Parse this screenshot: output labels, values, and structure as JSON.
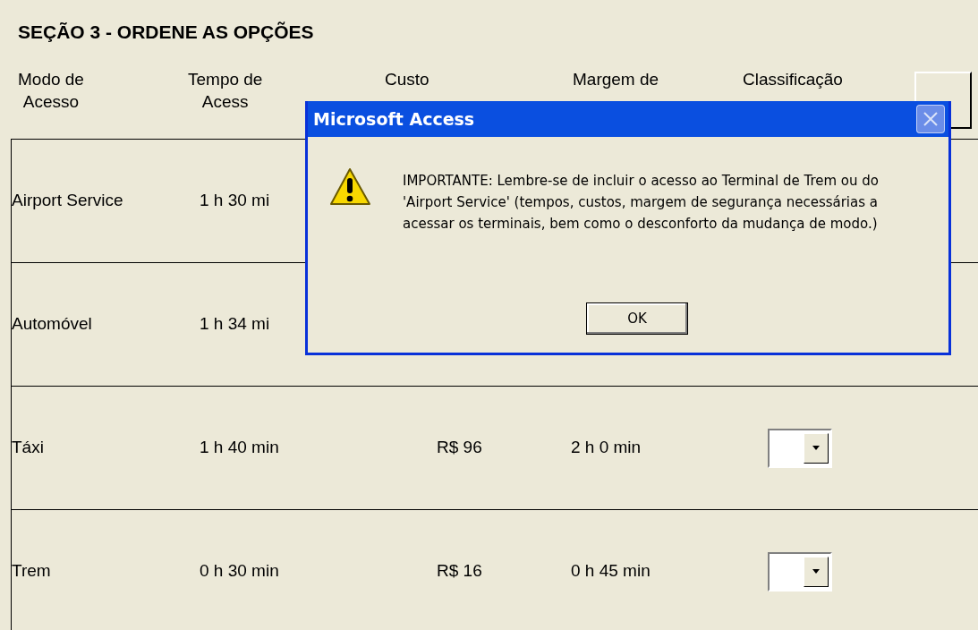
{
  "section_title": "SEÇÃO 3 - ORDENE AS OPÇÕES",
  "columns": [
    {
      "lines": [
        "Modo de",
        "Acesso"
      ]
    },
    {
      "lines": [
        "Tempo de",
        "Acess"
      ]
    },
    {
      "lines": [
        "Custo"
      ]
    },
    {
      "lines": [
        "Margem de"
      ]
    },
    {
      "lines": [
        "Classificação"
      ]
    }
  ],
  "rows": [
    {
      "mode": "Airport Service",
      "time": "1 h 30 mi"
    },
    {
      "mode": "Automóvel",
      "time": "1 h 34 mi"
    },
    {
      "mode": "Táxi",
      "time": "1 h 40 min",
      "cost": "R$ 96",
      "margin": "2 h 0 min",
      "has_dropdown": true
    },
    {
      "mode": "Trem",
      "time": "0 h 30 min",
      "cost": "R$ 16",
      "margin": "0 h 45 min",
      "has_dropdown": true
    }
  ],
  "dialog": {
    "title": "Microsoft Access",
    "message": "IMPORTANTE: Lembre-se de incluir o acesso ao Terminal de Trem ou do 'Airport Service' (tempos, custos, margem de segurança necessárias a acessar os terminais, bem como o desconforto da mudança de modo.)",
    "button": "OK"
  }
}
